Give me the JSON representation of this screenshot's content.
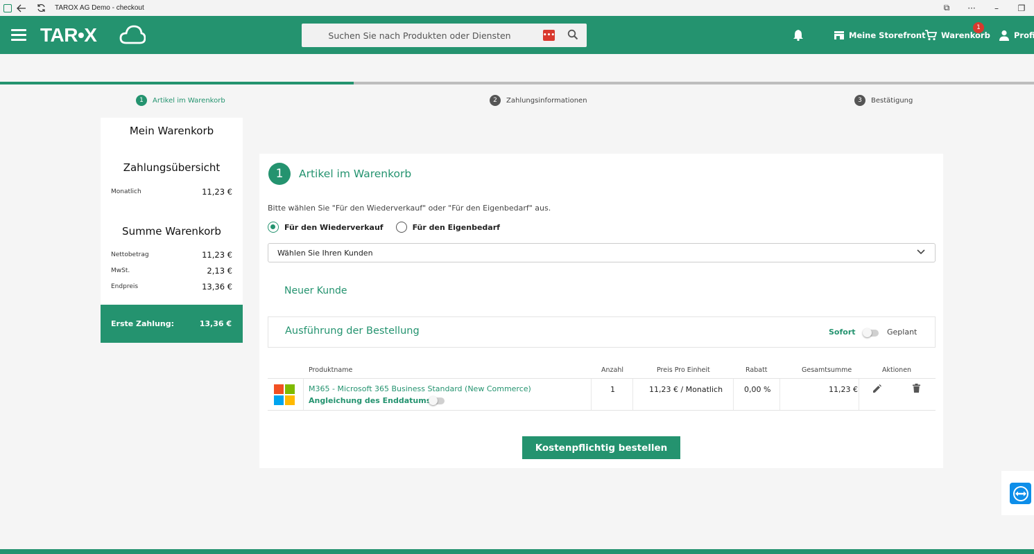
{
  "window": {
    "title": "TAROX AG Demo - checkout"
  },
  "header": {
    "logo": "TAR•X",
    "search_placeholder": "Suchen Sie nach Produkten oder Diensten",
    "storefront": "Meine Storefront",
    "cart": "Warenkorb",
    "cart_count": "1",
    "profile": "Profil"
  },
  "steps": [
    {
      "num": "1",
      "label": "Artikel im Warenkorb"
    },
    {
      "num": "2",
      "label": "Zahlungsinformationen"
    },
    {
      "num": "3",
      "label": "Bestätigung"
    }
  ],
  "progress_fraction": 0.342,
  "sidebar": {
    "title": "Mein Warenkorb",
    "payment_overview": "Zahlungsübersicht",
    "monthly_label": "Monatlich",
    "monthly_value": "11,23 €",
    "cart_sum": "Summe Warenkorb",
    "net_label": "Nettobetrag",
    "net_value": "11,23 €",
    "vat_label": "MwSt.",
    "vat_value": "2,13 €",
    "total_label": "Endpreis",
    "total_value": "13,36 €",
    "first_payment_label": "Erste Zahlung:",
    "first_payment_value": "13,36 €"
  },
  "main": {
    "step_num": "1",
    "title": "Artikel im Warenkorb",
    "hint": "Bitte wählen Sie \"Für den Wiederverkauf\" oder \"Für den Eigenbedarf\" aus.",
    "radio_resale": "Für den Wiederverkauf",
    "radio_own": "Für den Eigenbedarf",
    "customer_select": "Wählen Sie Ihren Kunden",
    "new_customer": "Neuer Kunde",
    "execution_title": "Ausführung der Bestellung",
    "sofort": "Sofort",
    "geplant": "Geplant",
    "table": {
      "headers": [
        "Produktname",
        "Anzahl",
        "Preis Pro Einheit",
        "Rabatt",
        "Gesamtsumme",
        "Aktionen"
      ],
      "row": {
        "product": "M365 - Microsoft 365 Business Standard (New Commerce)",
        "end_date_label": "Angleichung des Enddatums",
        "quantity": "1",
        "unit_price": "11,23 € / Monatlich",
        "discount": "0,00 %",
        "total": "11,23 €"
      }
    },
    "order_button": "Kostenpflichtig bestellen"
  },
  "colors": {
    "brand": "#24936f",
    "badge": "#d9392e",
    "teamviewer": "#0e8ee9"
  }
}
